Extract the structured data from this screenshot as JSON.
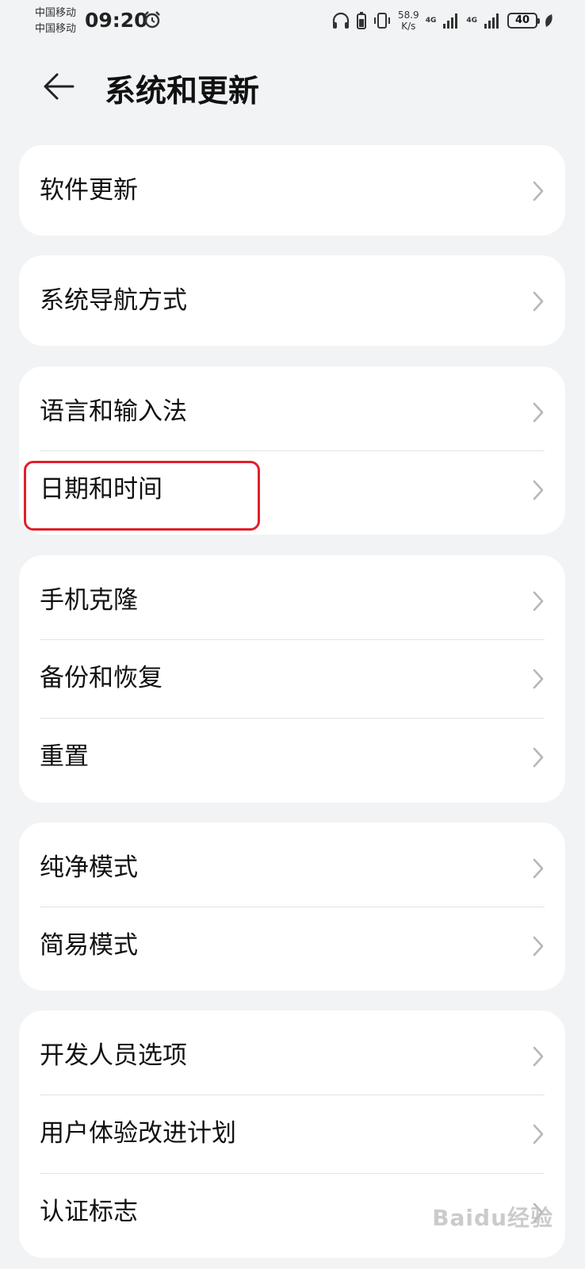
{
  "status_bar": {
    "carrier_1": "中国移动",
    "carrier_2": "中国移动",
    "time": "09:20",
    "net_speed_value": "58.9",
    "net_speed_unit": "K/s",
    "net_type_1": "4G",
    "net_type_2": "4G",
    "battery": "40"
  },
  "header": {
    "title": "系统和更新"
  },
  "groups": [
    {
      "items": [
        {
          "label": "软件更新"
        }
      ]
    },
    {
      "items": [
        {
          "label": "系统导航方式"
        }
      ]
    },
    {
      "items": [
        {
          "label": "语言和输入法"
        },
        {
          "label": "日期和时间"
        }
      ]
    },
    {
      "items": [
        {
          "label": "手机克隆"
        },
        {
          "label": "备份和恢复"
        },
        {
          "label": "重置"
        }
      ]
    },
    {
      "items": [
        {
          "label": "纯净模式"
        },
        {
          "label": "简易模式"
        }
      ]
    },
    {
      "items": [
        {
          "label": "开发人员选项"
        },
        {
          "label": "用户体验改进计划"
        },
        {
          "label": "认证标志"
        }
      ]
    }
  ],
  "watermark": "Baidu经验"
}
